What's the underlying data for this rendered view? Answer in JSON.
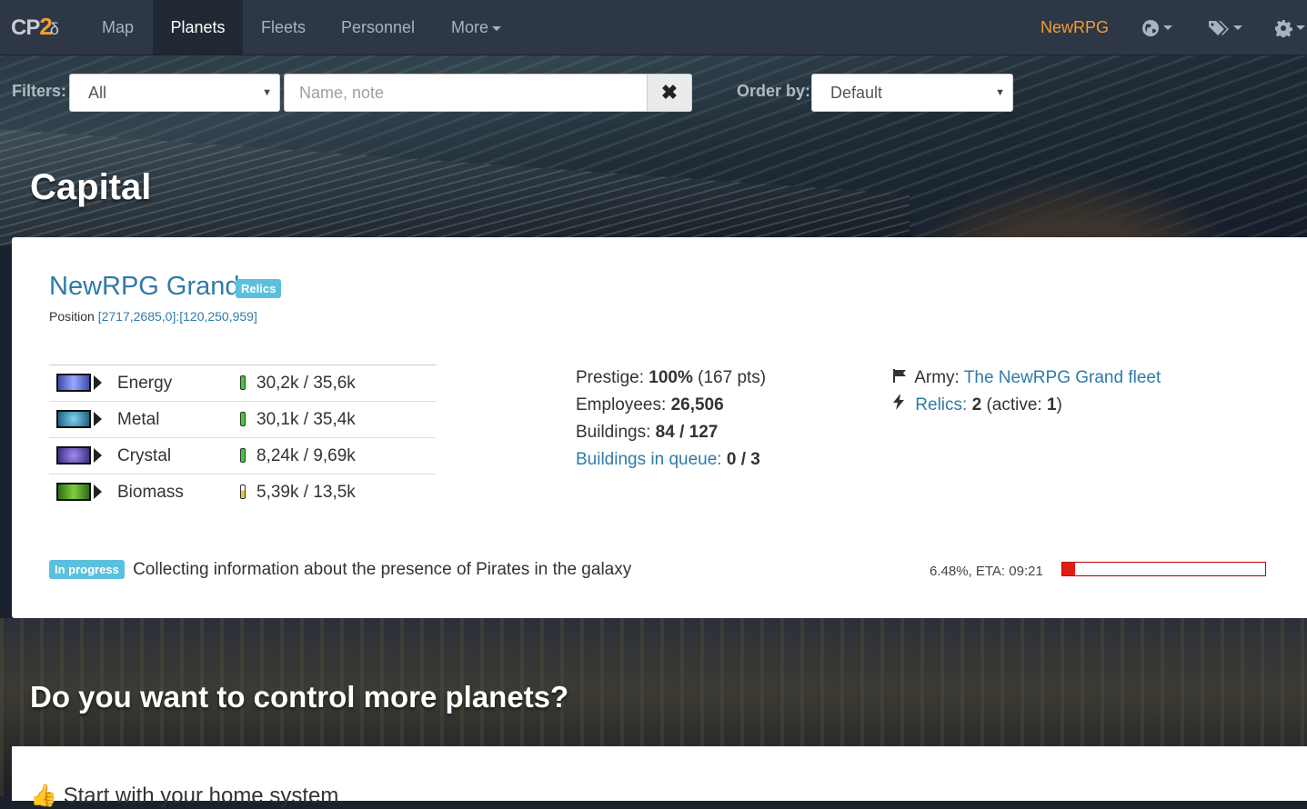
{
  "nav": {
    "brand_cp": "CP",
    "brand_2": "2",
    "brand_swirl": "δ",
    "items": [
      {
        "label": "Map"
      },
      {
        "label": "Planets",
        "active": true
      },
      {
        "label": "Fleets"
      },
      {
        "label": "Personnel"
      },
      {
        "label": "More"
      }
    ],
    "user": "NewRPG",
    "icons": [
      "globe-icon",
      "tags-icon",
      "gear-icon"
    ]
  },
  "filters": {
    "label": "Filters:",
    "filter_value": "All",
    "search_placeholder": "Name, note",
    "clear_symbol": "✖",
    "order_label": "Order by:",
    "order_value": "Default"
  },
  "capital": {
    "section_title": "Capital",
    "planet_name": "NewRPG Grand",
    "badge": "Relics",
    "position_label": "Position",
    "position_value": "[2717,2685,0]:[120,250,959]",
    "resources": [
      {
        "name": "Energy",
        "value": "30,2k / 35,6k",
        "level": "green",
        "icon_color": "#5a6ad0"
      },
      {
        "name": "Metal",
        "value": "30,1k / 35,4k",
        "level": "green",
        "icon_color": "#3a8fb5"
      },
      {
        "name": "Crystal",
        "value": "8,24k / 9,69k",
        "level": "green",
        "icon_color": "#6a4fb0"
      },
      {
        "name": "Biomass",
        "value": "5,39k / 13,5k",
        "level": "yellow",
        "icon_color": "#4a9a2a"
      }
    ],
    "stats": {
      "prestige_label": "Prestige:",
      "prestige_value": "100%",
      "prestige_pts": "(167 pts)",
      "employees_label": "Employees:",
      "employees_value": "26,506",
      "buildings_label": "Buildings:",
      "buildings_value": "84 / 127",
      "queue_label": "Buildings in queue:",
      "queue_value": "0 / 3"
    },
    "army": {
      "army_label": "Army:",
      "army_link": "The NewRPG Grand fleet",
      "relics_label": "Relics:",
      "relics_value": "2",
      "relics_active_prefix": "(active:",
      "relics_active_value": "1",
      "relics_active_suffix": ")"
    },
    "progress": {
      "badge": "In progress",
      "text": "Collecting information about the presence of Pirates in the galaxy",
      "eta": "6.48%, ETA: 09:21",
      "percent": 6.48
    }
  },
  "more": {
    "section_title": "Do you want to control more planets?",
    "panel_title": "Start with your home system"
  },
  "colors": {
    "accent_link": "#2f7ba7",
    "user_orange": "#f29e2f",
    "badge_blue": "#5bc0de",
    "progress_red": "#e31b10"
  }
}
